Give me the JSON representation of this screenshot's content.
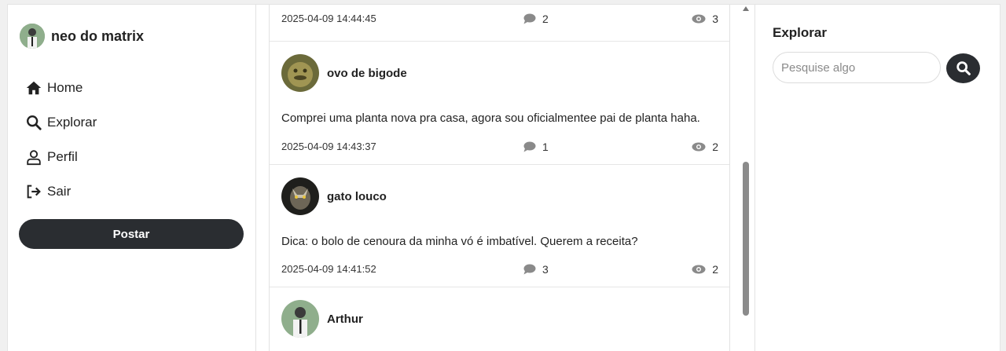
{
  "user": {
    "name": "neo do matrix"
  },
  "nav": {
    "home": "Home",
    "explore": "Explorar",
    "profile": "Perfil",
    "logout": "Sair"
  },
  "post_button": "Postar",
  "feed": {
    "posts": [
      {
        "date": "2025-04-09 14:44:45",
        "comments": "2",
        "views": "3"
      },
      {
        "author": "ovo de bigode",
        "text": "Comprei uma planta nova pra casa, agora sou oficialmentee pai de planta haha.",
        "date": "2025-04-09 14:43:37",
        "comments": "1",
        "views": "2"
      },
      {
        "author": "gato louco",
        "text": "Dica: o bolo de cenoura da minha vó é imbatível. Querem a receita?",
        "date": "2025-04-09 14:41:52",
        "comments": "3",
        "views": "2"
      },
      {
        "author": "Arthur"
      }
    ]
  },
  "explore_panel": {
    "title": "Explorar",
    "search_placeholder": "Pesquise algo"
  },
  "icons": {
    "home": "home-icon",
    "explore": "search-icon",
    "profile": "user-icon",
    "logout": "logout-icon",
    "comment": "comment-icon",
    "views": "eye-icon"
  },
  "colors": {
    "button_dark": "#2a2d31",
    "icon_gray": "#8a8a8a"
  }
}
